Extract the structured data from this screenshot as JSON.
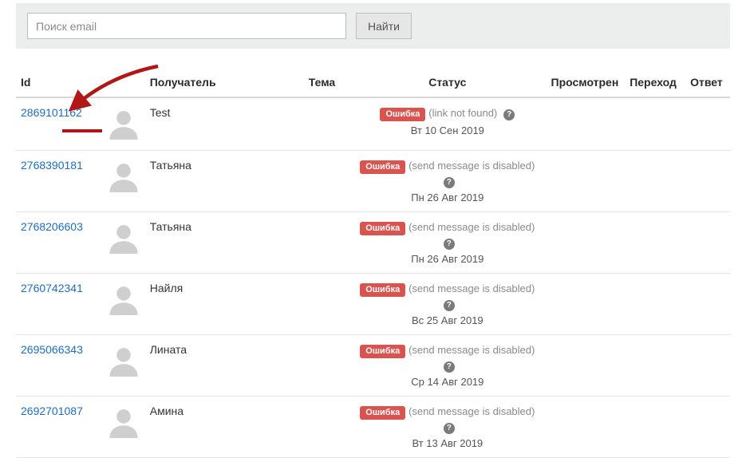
{
  "search": {
    "placeholder": "Поиск email",
    "button": "Найти"
  },
  "headers": {
    "id": "Id",
    "recipient": "Получатель",
    "subject": "Тема",
    "status": "Статус",
    "viewed": "Просмотрен",
    "click": "Переход",
    "reply": "Ответ"
  },
  "badge_error": "Ошибка",
  "rows": [
    {
      "id": "2869101162",
      "recipient": "Test",
      "status_note": "(link not found)",
      "date": "Вт 10 Сен 2019"
    },
    {
      "id": "2768390181",
      "recipient": "Татьяна",
      "status_note": "(send message is disabled)",
      "date": "Пн 26 Авг 2019"
    },
    {
      "id": "2768206603",
      "recipient": "Татьяна",
      "status_note": "(send message is disabled)",
      "date": "Пн 26 Авг 2019"
    },
    {
      "id": "2760742341",
      "recipient": "Найля",
      "status_note": "(send message is disabled)",
      "date": "Вс 25 Авг 2019"
    },
    {
      "id": "2695066343",
      "recipient": "Лината",
      "status_note": "(send message is disabled)",
      "date": "Ср 14 Авг 2019"
    },
    {
      "id": "2692701087",
      "recipient": "Амина",
      "status_note": "(send message is disabled)",
      "date": "Вт 13 Авг 2019"
    }
  ]
}
